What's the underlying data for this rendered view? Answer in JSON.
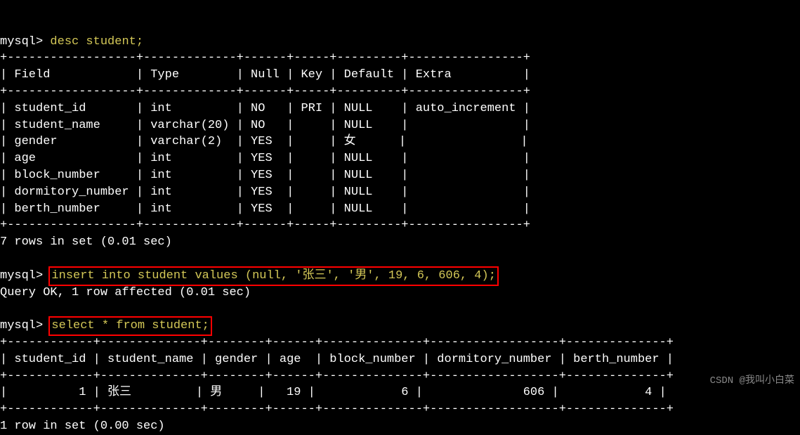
{
  "prompt": "mysql>",
  "commands": {
    "desc": "desc student;",
    "insert": "insert into student values (null, '张三', '男', 19, 6, 606, 4);",
    "select": "select * from student;"
  },
  "desc_table": {
    "border_top": "+------------------+-------------+------+-----+---------+----------------+",
    "header_line": "| Field            | Type        | Null | Key | Default | Extra          |",
    "border_mid": "+------------------+-------------+------+-----+---------+----------------+",
    "rows": [
      "| student_id       | int         | NO   | PRI | NULL    | auto_increment |",
      "| student_name     | varchar(20) | NO   |     | NULL    |                |",
      "| gender           | varchar(2)  | YES  |     | 女      |                |",
      "| age              | int         | YES  |     | NULL    |                |",
      "| block_number     | int         | YES  |     | NULL    |                |",
      "| dormitory_number | int         | YES  |     | NULL    |                |",
      "| berth_number     | int         | YES  |     | NULL    |                |"
    ],
    "border_bot": "+------------------+-------------+------+-----+---------+----------------+",
    "summary": "7 rows in set (0.01 sec)"
  },
  "insert_result": "Query OK, 1 row affected (0.01 sec)",
  "select_table": {
    "border_top": "+------------+--------------+--------+------+--------------+------------------+--------------+",
    "header_line": "| student_id | student_name | gender | age  | block_number | dormitory_number | berth_number |",
    "border_mid": "+------------+--------------+--------+------+--------------+------------------+--------------+",
    "rows": [
      "|          1 | 张三         | 男     |   19 |            6 |              606 |            4 |"
    ],
    "border_bot": "+------------+--------------+--------+------+--------------+------------------+--------------+",
    "summary": "1 row in set (0.00 sec)"
  },
  "watermark": "CSDN @我叫小白菜"
}
